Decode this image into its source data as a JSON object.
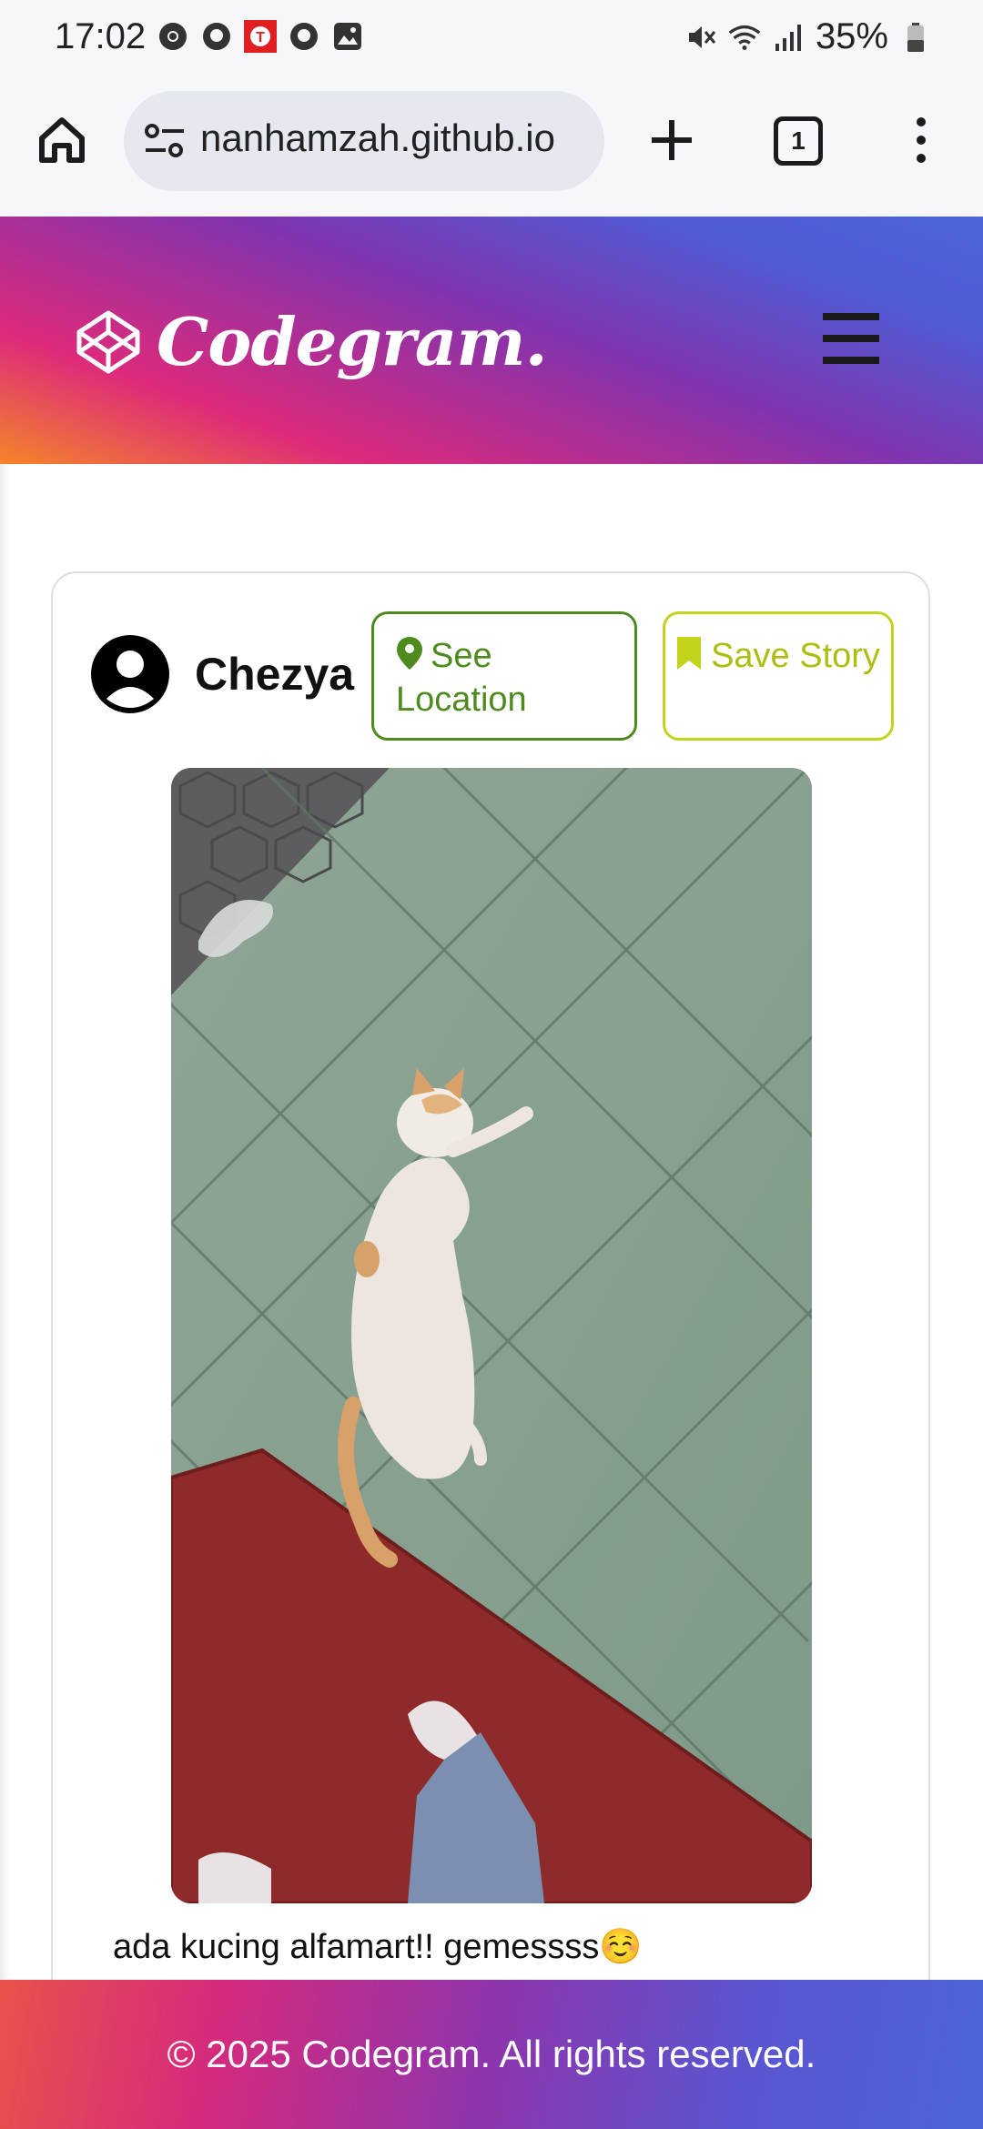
{
  "status_bar": {
    "time": "17:02",
    "battery": "35%"
  },
  "browser": {
    "url": "nanhamzah.github.io",
    "tab_count": "1"
  },
  "header": {
    "logo_text": "Codegram."
  },
  "post": {
    "username": "Chezya",
    "see_location_label": "See Location",
    "save_story_label": "Save Story",
    "caption": "ada kucing alfamart!! gemessss☺️"
  },
  "footer": {
    "copyright": "© 2025 Codegram. All rights reserved."
  },
  "colors": {
    "location_green": "#4f8a1e",
    "save_lime": "#c3d31a",
    "gradient": [
      "#f58529",
      "#dd2a7b",
      "#8134af",
      "#515bd4"
    ]
  }
}
